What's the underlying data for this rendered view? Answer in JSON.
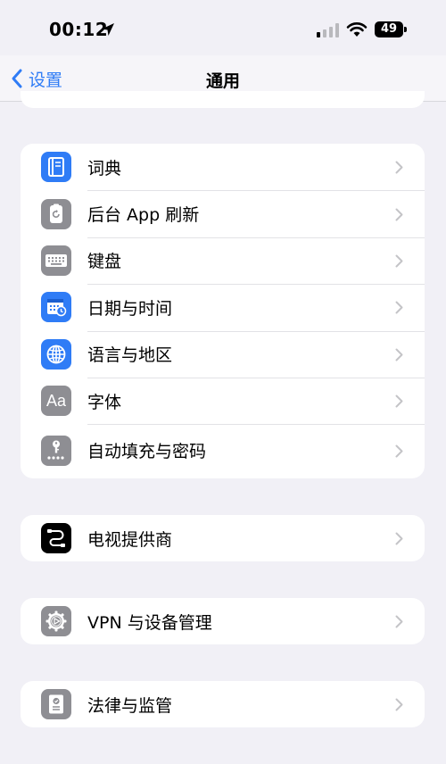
{
  "status_bar": {
    "time": "00:12",
    "battery": "49"
  },
  "nav": {
    "back_label": "设置",
    "title": "通用"
  },
  "groups": [
    {
      "rows": [
        {
          "label": "词典",
          "icon": "dictionary-icon",
          "color": "#2f7cf6"
        },
        {
          "label": "后台 App 刷新",
          "icon": "background-refresh-icon",
          "color": "#8e8e93"
        },
        {
          "label": "键盘",
          "icon": "keyboard-icon",
          "color": "#8e8e93"
        },
        {
          "label": "日期与时间",
          "icon": "calendar-clock-icon",
          "color": "#2f7cf6"
        },
        {
          "label": "语言与地区",
          "icon": "globe-icon",
          "color": "#2f7cf6"
        },
        {
          "label": "字体",
          "icon": "font-icon",
          "color": "#8e8e93"
        },
        {
          "label": "自动填充与密码",
          "icon": "key-icon",
          "color": "#8e8e93"
        }
      ]
    },
    {
      "rows": [
        {
          "label": "电视提供商",
          "icon": "tv-provider-icon",
          "color": "#000000"
        }
      ]
    },
    {
      "rows": [
        {
          "label": "VPN 与设备管理",
          "icon": "gear-icon",
          "color": "#8e8e93"
        }
      ]
    },
    {
      "rows": [
        {
          "label": "法律与监管",
          "icon": "legal-document-icon",
          "color": "#8e8e93"
        }
      ]
    }
  ],
  "colors": {
    "accent": "#2f7cf6",
    "background": "#f1f0f6",
    "chevron": "#c4c4c7"
  },
  "icon_glyphs": {
    "font": "Aa"
  }
}
